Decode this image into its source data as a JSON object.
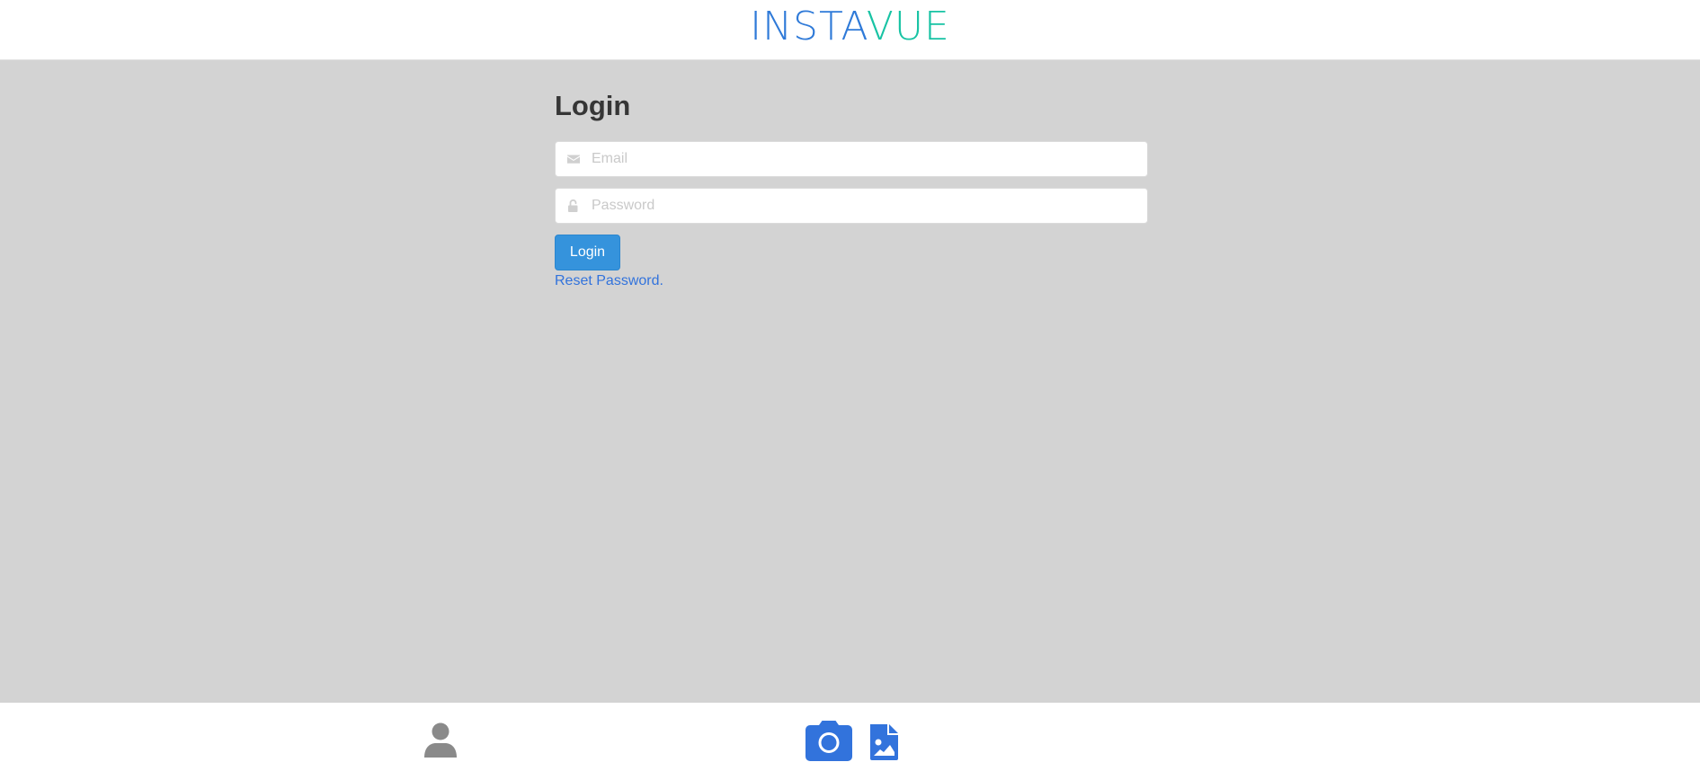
{
  "header": {
    "logo_part1": "INSTA",
    "logo_part2": "VUE"
  },
  "login_form": {
    "title": "Login",
    "email": {
      "placeholder": "Email",
      "value": "",
      "icon": "envelope-icon"
    },
    "password": {
      "placeholder": "Password",
      "value": "",
      "icon": "unlock-icon"
    },
    "login_button_label": "Login",
    "reset_link_label": "Reset Password."
  },
  "bottom_nav": {
    "items": [
      {
        "icon": "user-icon"
      },
      {
        "icon": "camera-icon"
      },
      {
        "icon": "file-image-icon"
      }
    ]
  },
  "colors": {
    "brand_blue": "#2f7ad8",
    "brand_teal": "#18c3a4",
    "background": "#d3d3d3",
    "button_blue": "#3593dc",
    "link_blue": "#3273dc",
    "nav_active": "#3273dc",
    "nav_inactive": "#8a8a8a"
  }
}
